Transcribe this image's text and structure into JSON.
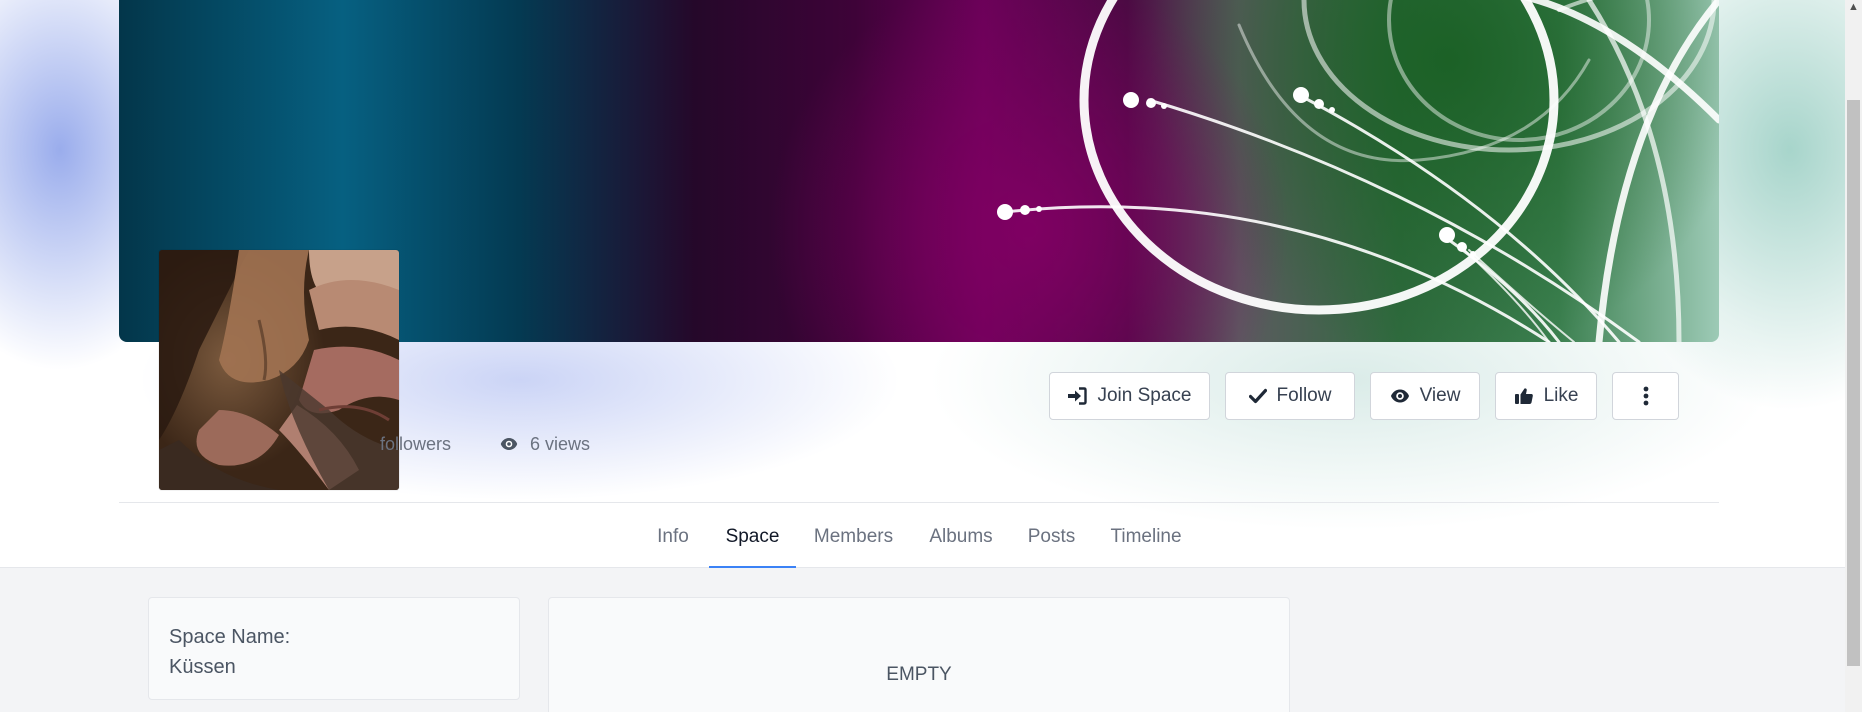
{
  "profile": {
    "followers_label": "followers",
    "views_label": "6 views"
  },
  "actions": {
    "join_label": "Join Space",
    "follow_label": "Follow",
    "view_label": "View",
    "like_label": "Like"
  },
  "tabs": [
    {
      "label": "Info",
      "active": false
    },
    {
      "label": "Space",
      "active": true
    },
    {
      "label": "Members",
      "active": false
    },
    {
      "label": "Albums",
      "active": false
    },
    {
      "label": "Posts",
      "active": false
    },
    {
      "label": "Timeline",
      "active": false
    }
  ],
  "info_card": {
    "label": "Space Name:",
    "value": "Küssen"
  },
  "main_card": {
    "empty_text": "EMPTY"
  },
  "colors": {
    "active_tab_underline": "#3b82f6",
    "page_content_bg": "#f3f4f6"
  },
  "icons": [
    "sign-in-icon",
    "check-icon",
    "eye-icon",
    "thumbs-up-icon",
    "ellipsis-vertical-icon",
    "scroll-up-arrow-icon"
  ]
}
